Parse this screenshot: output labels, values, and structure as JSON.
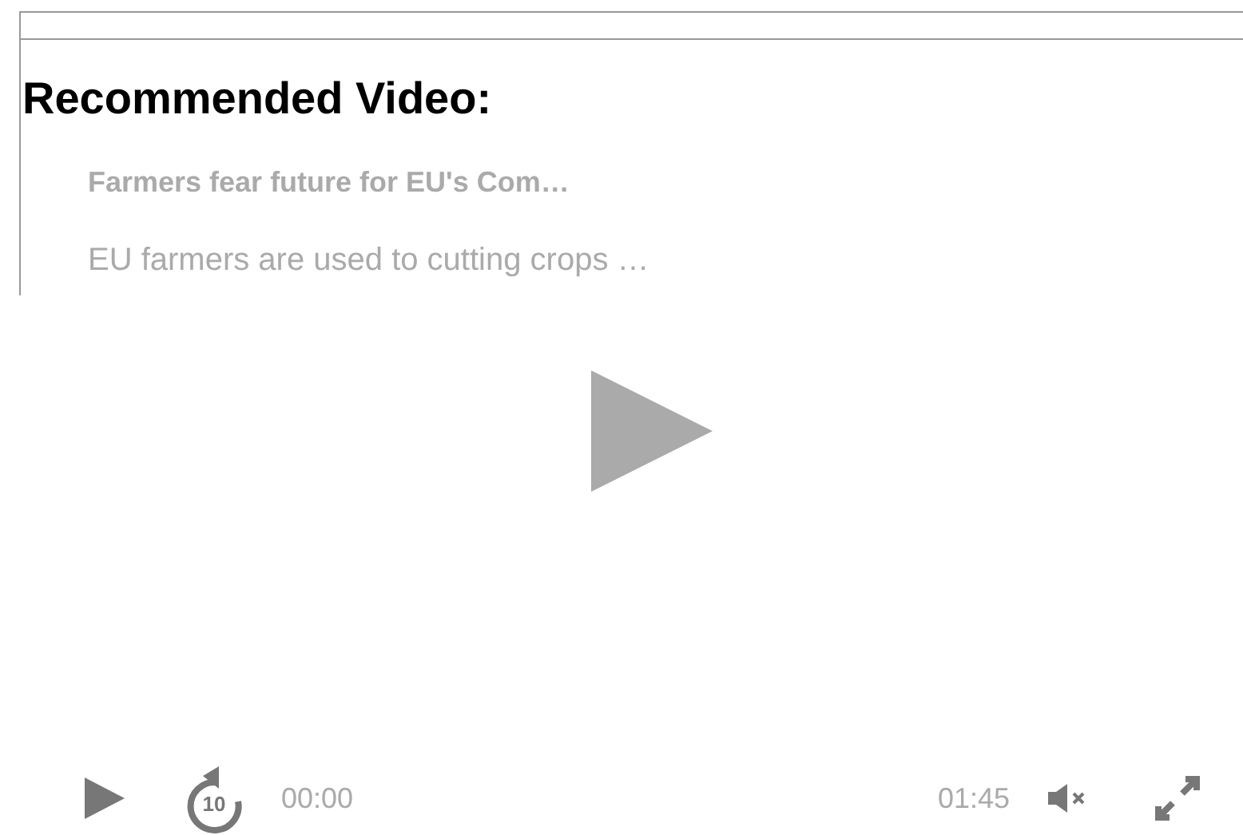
{
  "heading": "Recommended Video:",
  "video": {
    "title": "Farmers fear future for EU's Com…",
    "description": "EU farmers are used to cutting crops …",
    "controls": {
      "skip_label": "10",
      "current_time": "00:00",
      "duration": "01:45",
      "muted": true
    }
  }
}
